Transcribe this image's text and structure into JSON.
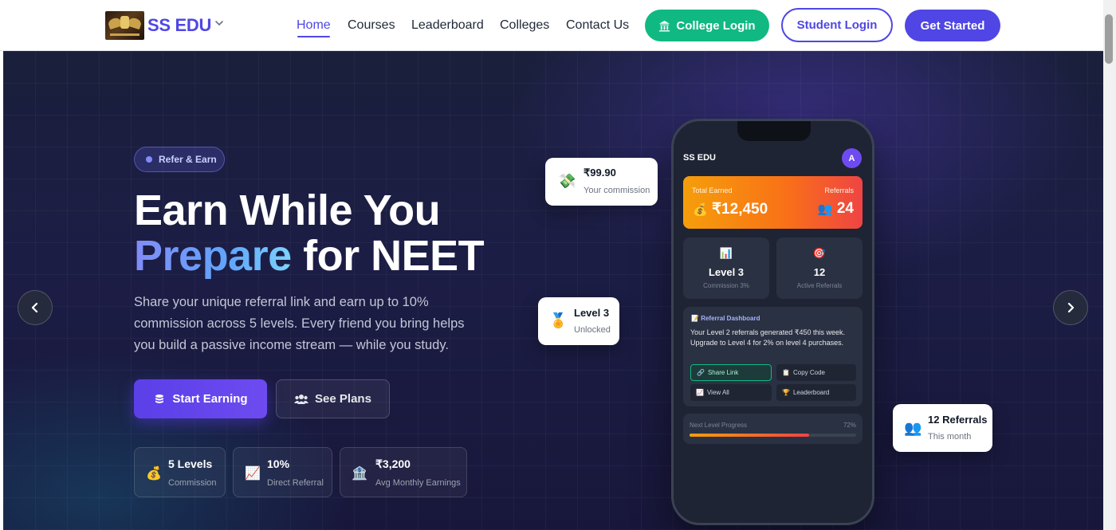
{
  "header": {
    "brand": "SS EDU",
    "nav": [
      "Home",
      "Courses",
      "Leaderboard",
      "Colleges",
      "Contact Us"
    ],
    "college_login": "College Login",
    "student_login": "Student Login",
    "get_started": "Get Started"
  },
  "hero": {
    "badge": "Refer & Earn",
    "title_line1": "Earn While You",
    "title_highlight": "Prepare",
    "title_rest": "for NEET",
    "lead": "Share your unique referral link and earn up to 10% commission across 5 levels. Every friend you bring helps you build a passive income stream — while you study.",
    "primary_cta": "Start Earning",
    "secondary_cta": "See Plans",
    "stats": [
      {
        "icon": "money-bag-icon",
        "value": "5 Levels",
        "label": "Commission"
      },
      {
        "icon": "chart-icon",
        "value": "10%",
        "label": "Direct Referral"
      },
      {
        "icon": "bank-icon",
        "value": "₹3,200",
        "label": "Avg Monthly Earnings"
      }
    ]
  },
  "floats": {
    "commission": {
      "value": "₹99.90",
      "label": "Your commission"
    },
    "level": {
      "value": "Level 3",
      "label": "Unlocked"
    },
    "referrals": {
      "value": "12 Referrals",
      "label": "This month"
    }
  },
  "phone": {
    "brand": "SS EDU",
    "avatar": "A",
    "earned_label": "Total Earned",
    "earned_value": "₹12,450",
    "referrals_label": "Referrals",
    "referrals_value": "24",
    "tiles": [
      {
        "value": "Level 3",
        "label": "Commission 3%"
      },
      {
        "value": "12",
        "label": "Active Referrals"
      }
    ],
    "dashboard_title": "Referral Dashboard",
    "dashboard_text": "Your Level 2 referrals generated ₹450 this week. Upgrade to Level 4 for 2% on level 4 purchases.",
    "actions": [
      "Share Link",
      "Copy Code",
      "View All",
      "Leaderboard"
    ],
    "progress_label": "Next Level Progress",
    "progress_text": "72%",
    "progress_value": 0.72
  },
  "colors": {
    "primary": "#4f46e5",
    "success": "#10b981",
    "hero_bg": "#1c1d45"
  }
}
